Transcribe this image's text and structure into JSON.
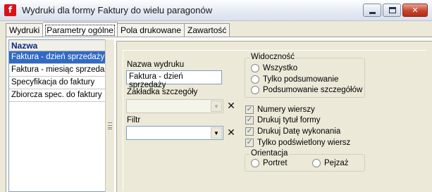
{
  "window": {
    "app_icon_letter": "f",
    "title": "Wydruki dla formy Faktury do wielu paragonów",
    "buttons": {
      "minimize": "minimize",
      "maximize": "maximize",
      "close": "✕"
    }
  },
  "tabs": [
    {
      "label": "Wydruki",
      "active": false
    },
    {
      "label": "Parametry ogólne",
      "active": true
    },
    {
      "label": "Pola drukowane",
      "active": false
    },
    {
      "label": "Zawartość",
      "active": false
    }
  ],
  "list": {
    "header": "Nazwa",
    "items": [
      {
        "label": "Faktura - dzień sprzedaży",
        "selected": true
      },
      {
        "label": "Faktura - miesiąc sprzedaży",
        "selected": false
      },
      {
        "label": "Specyfikacja do faktury",
        "selected": false
      },
      {
        "label": "Zbiorcza spec. do faktury",
        "selected": false
      }
    ]
  },
  "form": {
    "name_label": "Nazwa wydruku",
    "name_value": "Faktura - dzień sprzedaży",
    "detail_tab_label": "Zakładka szczegóły",
    "detail_tab_value": "",
    "filter_label": "Filtr",
    "filter_value": "",
    "clear_glyph": "✕",
    "visibility": {
      "title": "Widoczność",
      "options": [
        "Wszystko",
        "Tylko podsumowanie",
        "Podsumowanie szczegółów"
      ]
    },
    "checkboxes": [
      {
        "label": "Numery wierszy",
        "checked": true
      },
      {
        "label": "Drukuj tytuł formy",
        "checked": true
      },
      {
        "label": "Drukuj Datę wykonania",
        "checked": true
      },
      {
        "label": "Tylko podświetlony wiersz",
        "checked": true
      }
    ],
    "orientation": {
      "title": "Orientacja",
      "options": [
        "Portret",
        "Pejzaż"
      ]
    }
  },
  "colors": {
    "selection": "#316ac5",
    "window_bg": "#ece9d8",
    "close_button": "#c6452c"
  }
}
